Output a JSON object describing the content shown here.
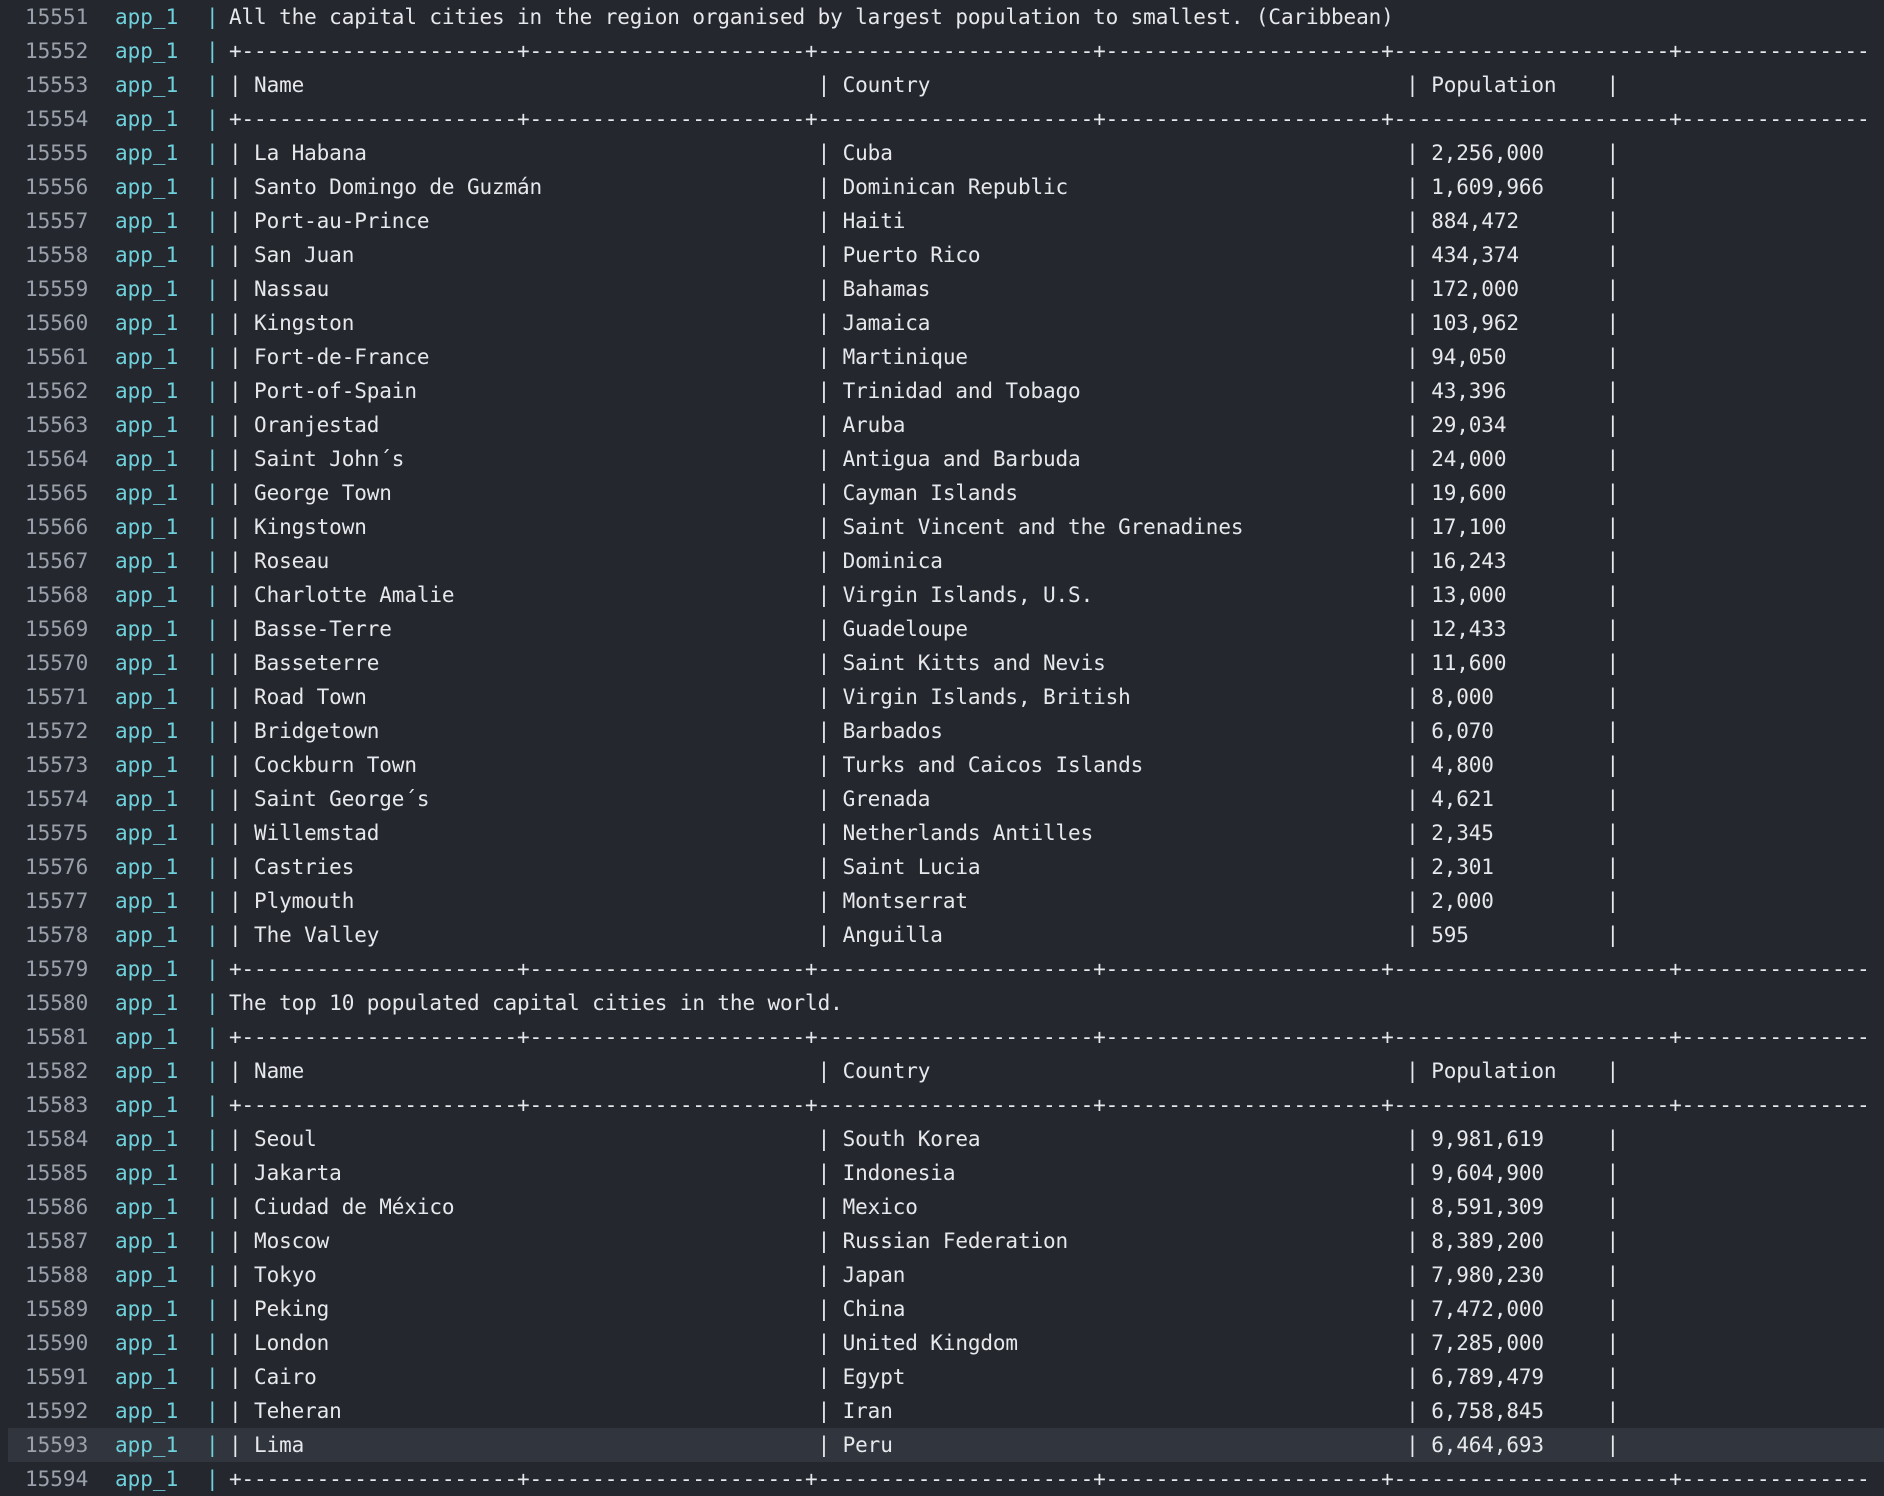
{
  "service": "app_1",
  "separator": "|",
  "lines": [
    {
      "n": "15551",
      "text": "All the capital cities in the region organised by largest population to smallest. (Caribbean)"
    },
    {
      "n": "15552",
      "text": "+----------------------+----------------------+----------------------+----------------------+----------------------+----------------------+----------------------+----------------------+-----------------------------+"
    },
    {
      "n": "15553",
      "text": "| Name                                         | Country                                      | Population    |"
    },
    {
      "n": "15554",
      "text": "+----------------------+----------------------+----------------------+----------------------+----------------------+----------------------+----------------------+----------------------+-----------------------------+"
    },
    {
      "n": "15555",
      "text": "| La Habana                                    | Cuba                                         | 2,256,000     |"
    },
    {
      "n": "15556",
      "text": "| Santo Domingo de Guzmán                      | Dominican Republic                           | 1,609,966     |"
    },
    {
      "n": "15557",
      "text": "| Port-au-Prince                               | Haiti                                        | 884,472       |"
    },
    {
      "n": "15558",
      "text": "| San Juan                                     | Puerto Rico                                  | 434,374       |"
    },
    {
      "n": "15559",
      "text": "| Nassau                                       | Bahamas                                      | 172,000       |"
    },
    {
      "n": "15560",
      "text": "| Kingston                                     | Jamaica                                      | 103,962       |"
    },
    {
      "n": "15561",
      "text": "| Fort-de-France                               | Martinique                                   | 94,050        |"
    },
    {
      "n": "15562",
      "text": "| Port-of-Spain                                | Trinidad and Tobago                          | 43,396        |"
    },
    {
      "n": "15563",
      "text": "| Oranjestad                                   | Aruba                                        | 29,034        |"
    },
    {
      "n": "15564",
      "text": "| Saint John´s                                 | Antigua and Barbuda                          | 24,000        |"
    },
    {
      "n": "15565",
      "text": "| George Town                                  | Cayman Islands                               | 19,600        |"
    },
    {
      "n": "15566",
      "text": "| Kingstown                                    | Saint Vincent and the Grenadines             | 17,100        |"
    },
    {
      "n": "15567",
      "text": "| Roseau                                       | Dominica                                     | 16,243        |"
    },
    {
      "n": "15568",
      "text": "| Charlotte Amalie                             | Virgin Islands, U.S.                         | 13,000        |"
    },
    {
      "n": "15569",
      "text": "| Basse-Terre                                  | Guadeloupe                                   | 12,433        |"
    },
    {
      "n": "15570",
      "text": "| Basseterre                                   | Saint Kitts and Nevis                        | 11,600        |"
    },
    {
      "n": "15571",
      "text": "| Road Town                                    | Virgin Islands, British                      | 8,000         |"
    },
    {
      "n": "15572",
      "text": "| Bridgetown                                   | Barbados                                     | 6,070         |"
    },
    {
      "n": "15573",
      "text": "| Cockburn Town                                | Turks and Caicos Islands                     | 4,800         |"
    },
    {
      "n": "15574",
      "text": "| Saint George´s                               | Grenada                                      | 4,621         |"
    },
    {
      "n": "15575",
      "text": "| Willemstad                                   | Netherlands Antilles                         | 2,345         |"
    },
    {
      "n": "15576",
      "text": "| Castries                                     | Saint Lucia                                  | 2,301         |"
    },
    {
      "n": "15577",
      "text": "| Plymouth                                     | Montserrat                                   | 2,000         |"
    },
    {
      "n": "15578",
      "text": "| The Valley                                   | Anguilla                                     | 595           |"
    },
    {
      "n": "15579",
      "text": "+----------------------+----------------------+----------------------+----------------------+----------------------+----------------------+----------------------+----------------------+-----------------------------+"
    },
    {
      "n": "15580",
      "text": "The top 10 populated capital cities in the world."
    },
    {
      "n": "15581",
      "text": "+----------------------+----------------------+----------------------+----------------------+----------------------+----------------------+----------------------+----------------------+-----------------------------+"
    },
    {
      "n": "15582",
      "text": "| Name                                         | Country                                      | Population    |"
    },
    {
      "n": "15583",
      "text": "+----------------------+----------------------+----------------------+----------------------+----------------------+----------------------+----------------------+----------------------+-----------------------------+"
    },
    {
      "n": "15584",
      "text": "| Seoul                                        | South Korea                                  | 9,981,619     |"
    },
    {
      "n": "15585",
      "text": "| Jakarta                                      | Indonesia                                    | 9,604,900     |"
    },
    {
      "n": "15586",
      "text": "| Ciudad de México                             | Mexico                                       | 8,591,309     |"
    },
    {
      "n": "15587",
      "text": "| Moscow                                       | Russian Federation                           | 8,389,200     |"
    },
    {
      "n": "15588",
      "text": "| Tokyo                                        | Japan                                        | 7,980,230     |"
    },
    {
      "n": "15589",
      "text": "| Peking                                       | China                                        | 7,472,000     |"
    },
    {
      "n": "15590",
      "text": "| London                                       | United Kingdom                               | 7,285,000     |"
    },
    {
      "n": "15591",
      "text": "| Cairo                                        | Egypt                                        | 6,789,479     |"
    },
    {
      "n": "15592",
      "text": "| Teheran                                      | Iran                                         | 6,758,845     |"
    },
    {
      "n": "15593",
      "text": "| Lima                                         | Peru                                         | 6,464,693     |",
      "highlighted": true
    },
    {
      "n": "15594",
      "text": "+----------------------+----------------------+----------------------+----------------------+----------------------+----------------------+----------------------+----------------------+-----------------------------+"
    }
  ]
}
